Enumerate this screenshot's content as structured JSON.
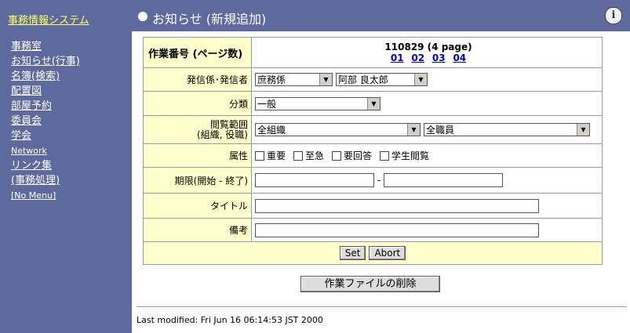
{
  "sidebar": {
    "brand": "事務情報システム",
    "items": [
      {
        "label": "事務室"
      },
      {
        "label": "お知らせ(行事)"
      },
      {
        "label": "名簿(検索)"
      },
      {
        "label": "配置図"
      },
      {
        "label": "部屋予約"
      },
      {
        "label": "委員会"
      },
      {
        "label": "学会"
      },
      {
        "label": "Network"
      },
      {
        "label": "リンク集"
      },
      {
        "label": "(事務処理)"
      },
      {
        "label": "[No Menu]"
      }
    ]
  },
  "header": {
    "title": "お知らせ (新規追加)",
    "icon": "info-icon"
  },
  "form": {
    "work_no_label": "作業番号 (ページ数)",
    "work_no_value": "110829 (4 page)",
    "pages": [
      "01",
      "02",
      "03",
      "04"
    ],
    "sender_label": "発信係･発信者",
    "sender_dept": "庶務係",
    "sender_person": "阿部 良太郎",
    "category_label": "分類",
    "category_value": "一般",
    "scope_label_1": "閲覧範囲",
    "scope_label_2": "(組織, 役職)",
    "scope_org": "全組織",
    "scope_position": "全職員",
    "attr_label": "属性",
    "attrs": [
      {
        "label": "重要"
      },
      {
        "label": "至急"
      },
      {
        "label": "要回答"
      },
      {
        "label": "学生閲覧"
      }
    ],
    "period_label": "期限(開始 - 終了)",
    "period_sep": "-",
    "period_start": "",
    "period_end": "",
    "title_label": "タイトル",
    "title_value": "",
    "note_label": "備考",
    "note_value": "",
    "set_label": "Set",
    "abort_label": "Abort"
  },
  "delete_label": "作業ファイルの削除",
  "footer": {
    "modified": "Last modified: Fri Jun 16 06:14:53 JST 2000"
  }
}
